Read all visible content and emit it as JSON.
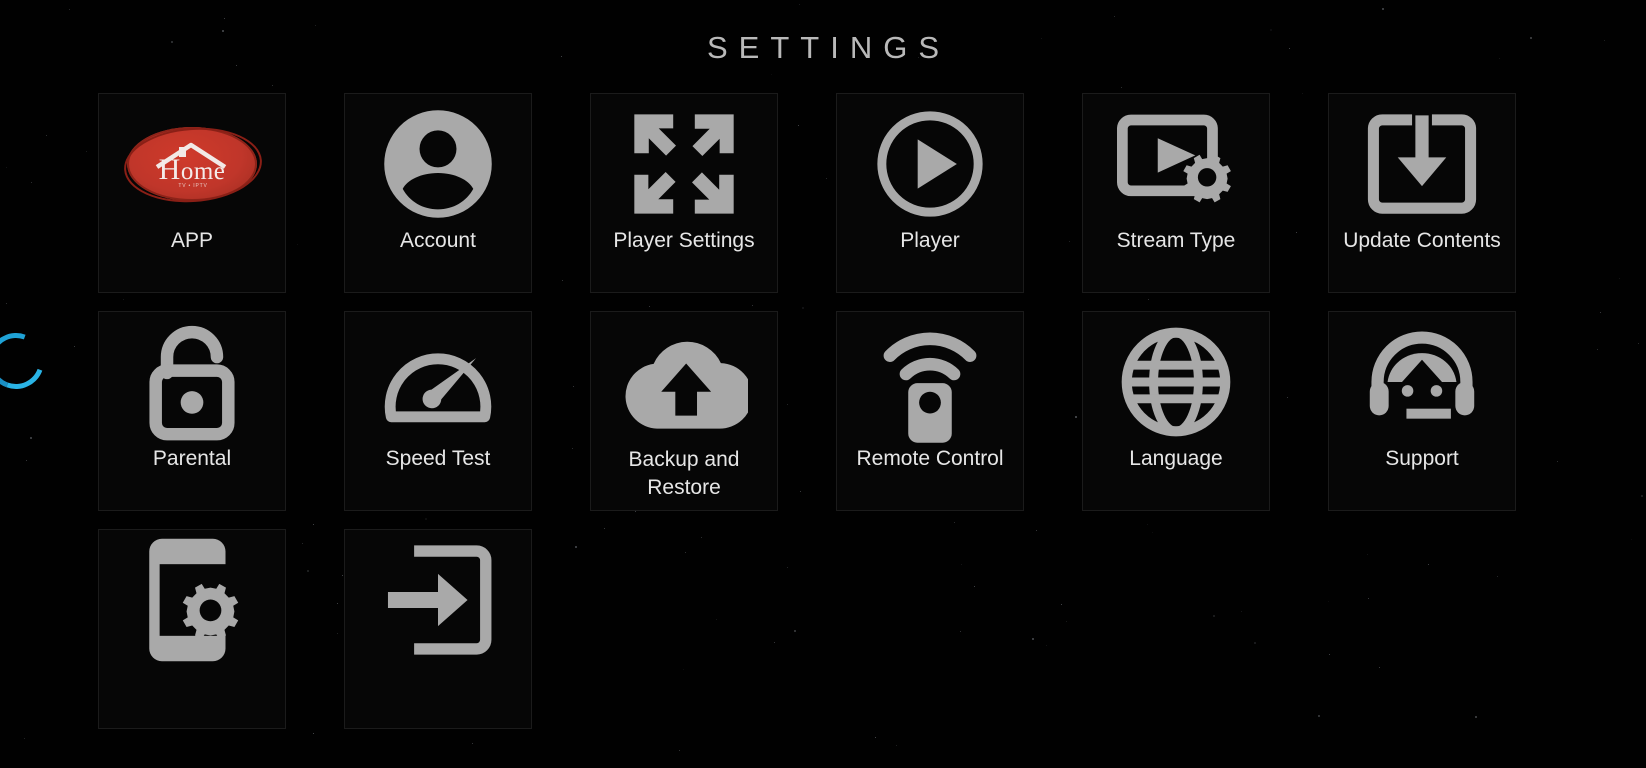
{
  "screen": {
    "title": "SETTINGS",
    "background_color": "#000000",
    "text_color": "#e6e6e6",
    "icon_color": "#a9a9a9",
    "accent_color": "#1fa2d6",
    "logo_color": "#c0362a"
  },
  "loading_indicator": {
    "name": "loading-spinner",
    "color": "#1fa2d6",
    "visible": true
  },
  "grid": {
    "columns": 6,
    "tiles": [
      {
        "id": "app",
        "label": "APP",
        "icon": "home-logo",
        "label_lines": 1,
        "partial": false
      },
      {
        "id": "account",
        "label": "Account",
        "icon": "account-icon",
        "label_lines": 1,
        "partial": false
      },
      {
        "id": "player-settings",
        "label": "Player Settings",
        "icon": "expand-arrows-icon",
        "label_lines": 1,
        "partial": false
      },
      {
        "id": "player",
        "label": "Player",
        "icon": "play-circle-icon",
        "label_lines": 1,
        "partial": false
      },
      {
        "id": "stream-type",
        "label": "Stream Type",
        "icon": "screen-gear-icon",
        "label_lines": 1,
        "partial": false
      },
      {
        "id": "update-contents",
        "label": "Update Contents",
        "icon": "download-box-icon",
        "label_lines": 1,
        "partial": false
      },
      {
        "id": "parental",
        "label": "Parental",
        "icon": "open-padlock-icon",
        "label_lines": 1,
        "partial": false
      },
      {
        "id": "speed-test",
        "label": "Speed Test",
        "icon": "speedometer-icon",
        "label_lines": 1,
        "partial": false
      },
      {
        "id": "backup-restore",
        "label": "Backup and Restore",
        "icon": "cloud-upload-icon",
        "label_lines": 2,
        "partial": false
      },
      {
        "id": "remote-control",
        "label": "Remote Control",
        "icon": "remote-control-icon",
        "label_lines": 1,
        "partial": false
      },
      {
        "id": "language",
        "label": "Language",
        "icon": "globe-icon",
        "label_lines": 1,
        "partial": false
      },
      {
        "id": "support",
        "label": "Support",
        "icon": "headset-support-icon",
        "label_lines": 1,
        "partial": false
      },
      {
        "id": "device-settings",
        "label": "",
        "icon": "phone-gear-icon",
        "label_lines": 0,
        "partial": true
      },
      {
        "id": "logout",
        "label": "",
        "icon": "login-arrow-icon",
        "label_lines": 0,
        "partial": true
      }
    ]
  },
  "logo": {
    "word": "Home",
    "subtext": "TV"
  }
}
